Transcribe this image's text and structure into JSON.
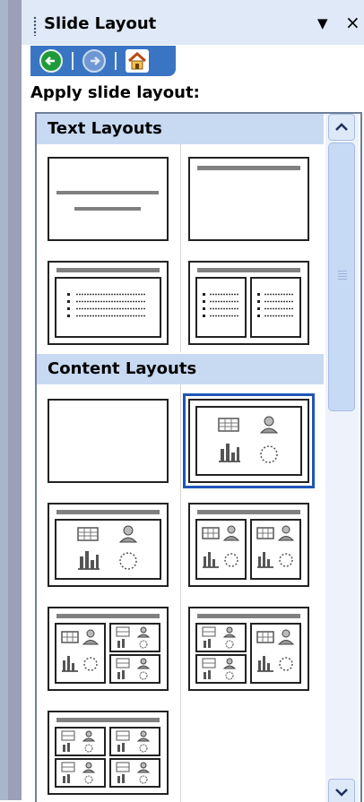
{
  "pane": {
    "title": "Slide Layout",
    "dropdown_icon": "▼",
    "close_icon": "×",
    "back_icon": "back-arrow",
    "forward_icon": "forward-arrow",
    "home_icon": "home"
  },
  "heading": "Apply slide layout:",
  "sections": {
    "text": "Text Layouts",
    "content": "Content Layouts"
  },
  "colors": {
    "accent": "#3a75c4",
    "section_bg": "#c8daf2",
    "selection": "#1e56b8"
  },
  "layouts": {
    "text": [
      "Title Slide",
      "Title Only",
      "Title and Text",
      "Title and 2-Column Text"
    ],
    "content": [
      "Blank",
      "Content",
      "Title and Content",
      "Title and 2 Content",
      "Title, Content and 2 Content",
      "Title, 2 Content and Content",
      "Title and 4 Content"
    ],
    "selected": "Content"
  }
}
